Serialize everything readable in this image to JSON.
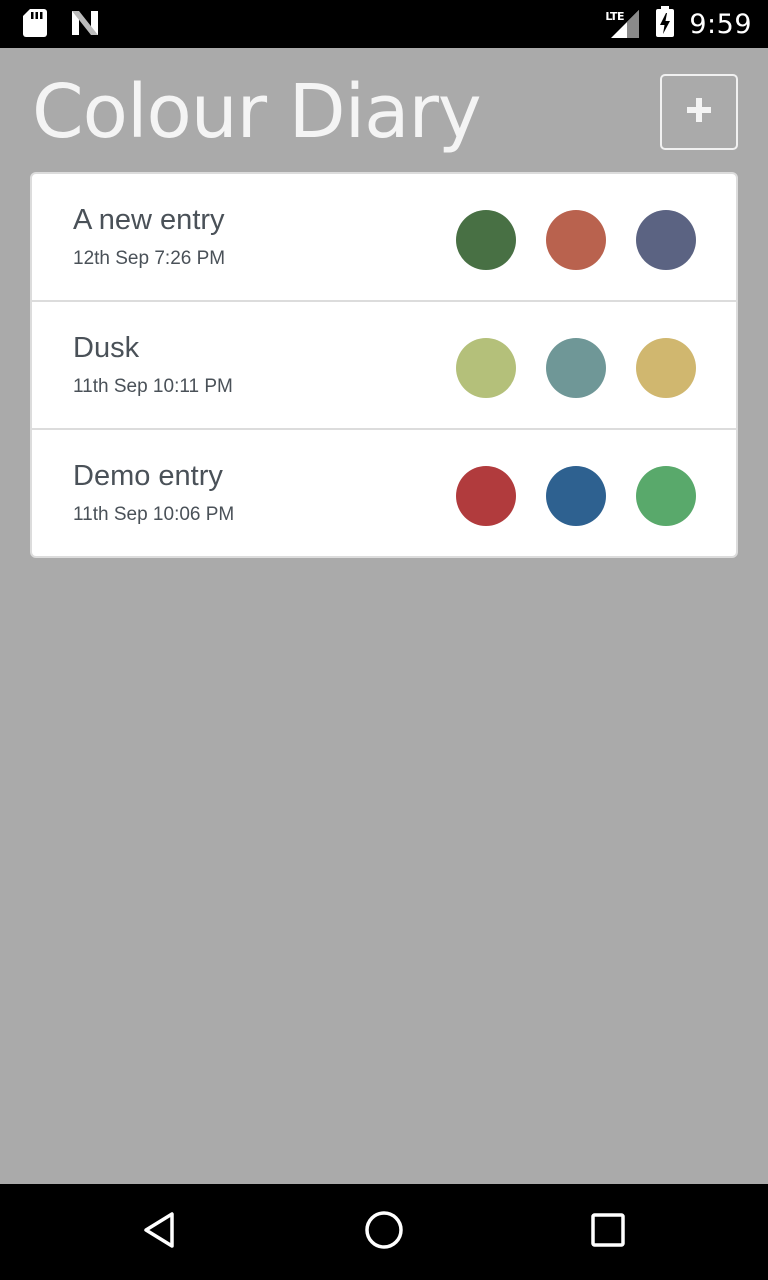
{
  "status_bar": {
    "network_label": "LTE",
    "time": "9:59",
    "icons": [
      "sd-card-icon",
      "n-logo-icon",
      "signal-icon",
      "battery-charging-icon"
    ]
  },
  "header": {
    "title": "Colour Diary",
    "add_button_icon": "plus-icon"
  },
  "entries": [
    {
      "title": "A new entry",
      "date": "12th Sep 7:26 PM",
      "colors": [
        "#487044",
        "#b9624e",
        "#5b6382"
      ]
    },
    {
      "title": "Dusk",
      "date": "11th Sep 10:11 PM",
      "colors": [
        "#b4c07a",
        "#6f9797",
        "#d0b76f"
      ]
    },
    {
      "title": "Demo entry",
      "date": "11th Sep 10:06 PM",
      "colors": [
        "#b13b3d",
        "#2e6190",
        "#59a96b"
      ]
    }
  ],
  "nav_bar": {
    "icons": [
      "back-icon",
      "home-icon",
      "recents-icon"
    ]
  },
  "colors": {
    "background": "#aaaaaa",
    "card": "#ffffff",
    "text": "#4a5158",
    "bars": "#000000"
  }
}
